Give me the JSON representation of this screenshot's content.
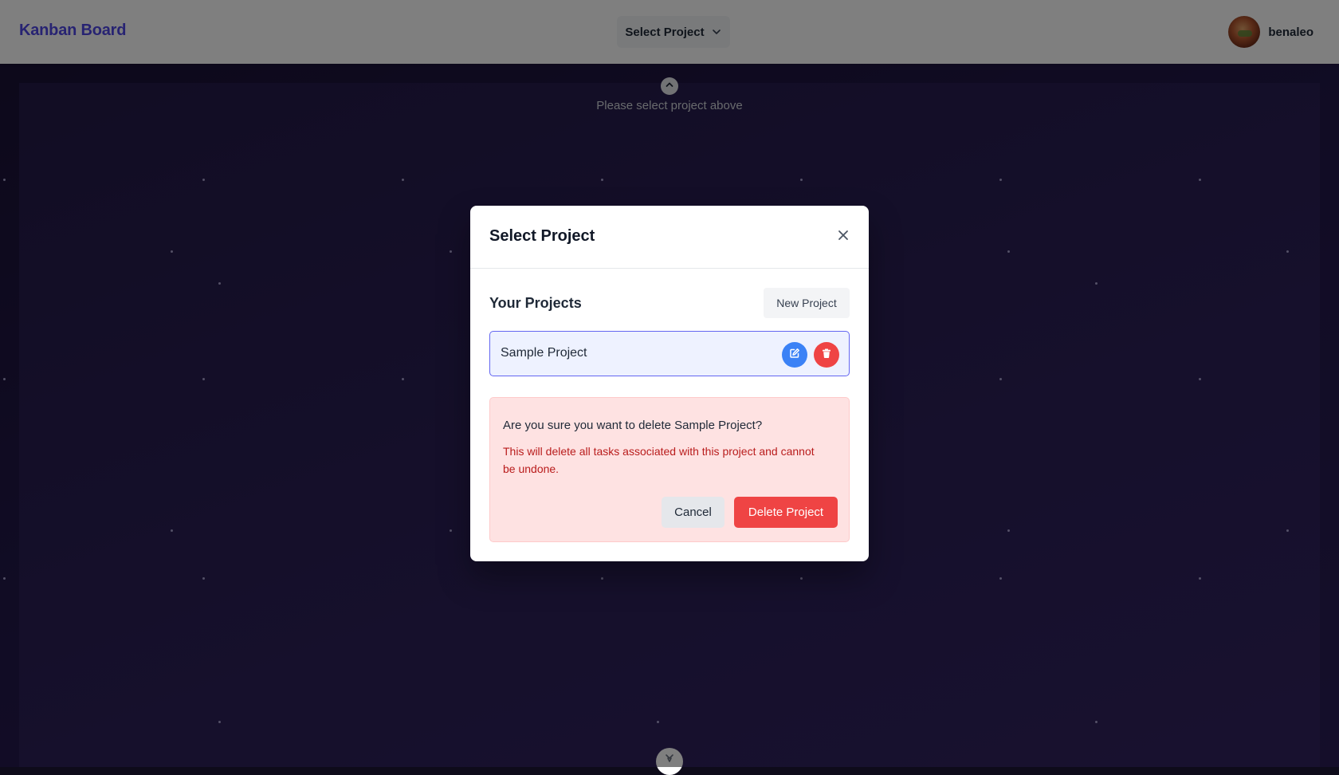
{
  "header": {
    "brand": "Kanban Board",
    "project_select_label": "Select Project",
    "username": "benaleo"
  },
  "board": {
    "hint": "Please select project above"
  },
  "modal": {
    "title": "Select Project",
    "section_title": "Your Projects",
    "new_project_label": "New Project",
    "projects": [
      {
        "name": "Sample Project"
      }
    ],
    "confirm": {
      "question": "Are you sure you want to delete Sample Project?",
      "warning": "This will delete all tasks associated with this project and cannot be undone.",
      "cancel_label": "Cancel",
      "delete_label": "Delete Project"
    }
  },
  "colors": {
    "brand": "#4f46e5",
    "edit": "#3b82f6",
    "danger": "#ef4444",
    "danger_bg": "#fee2e2",
    "danger_text": "#b91c1c",
    "selected_border": "#6366f1"
  },
  "icons": {
    "project_select": "chevron-down-icon",
    "close": "close-icon",
    "edit": "edit-icon",
    "delete": "trash-icon",
    "scroll_up": "chevron-up-icon",
    "scroll_down": "chevron-down-icon"
  }
}
